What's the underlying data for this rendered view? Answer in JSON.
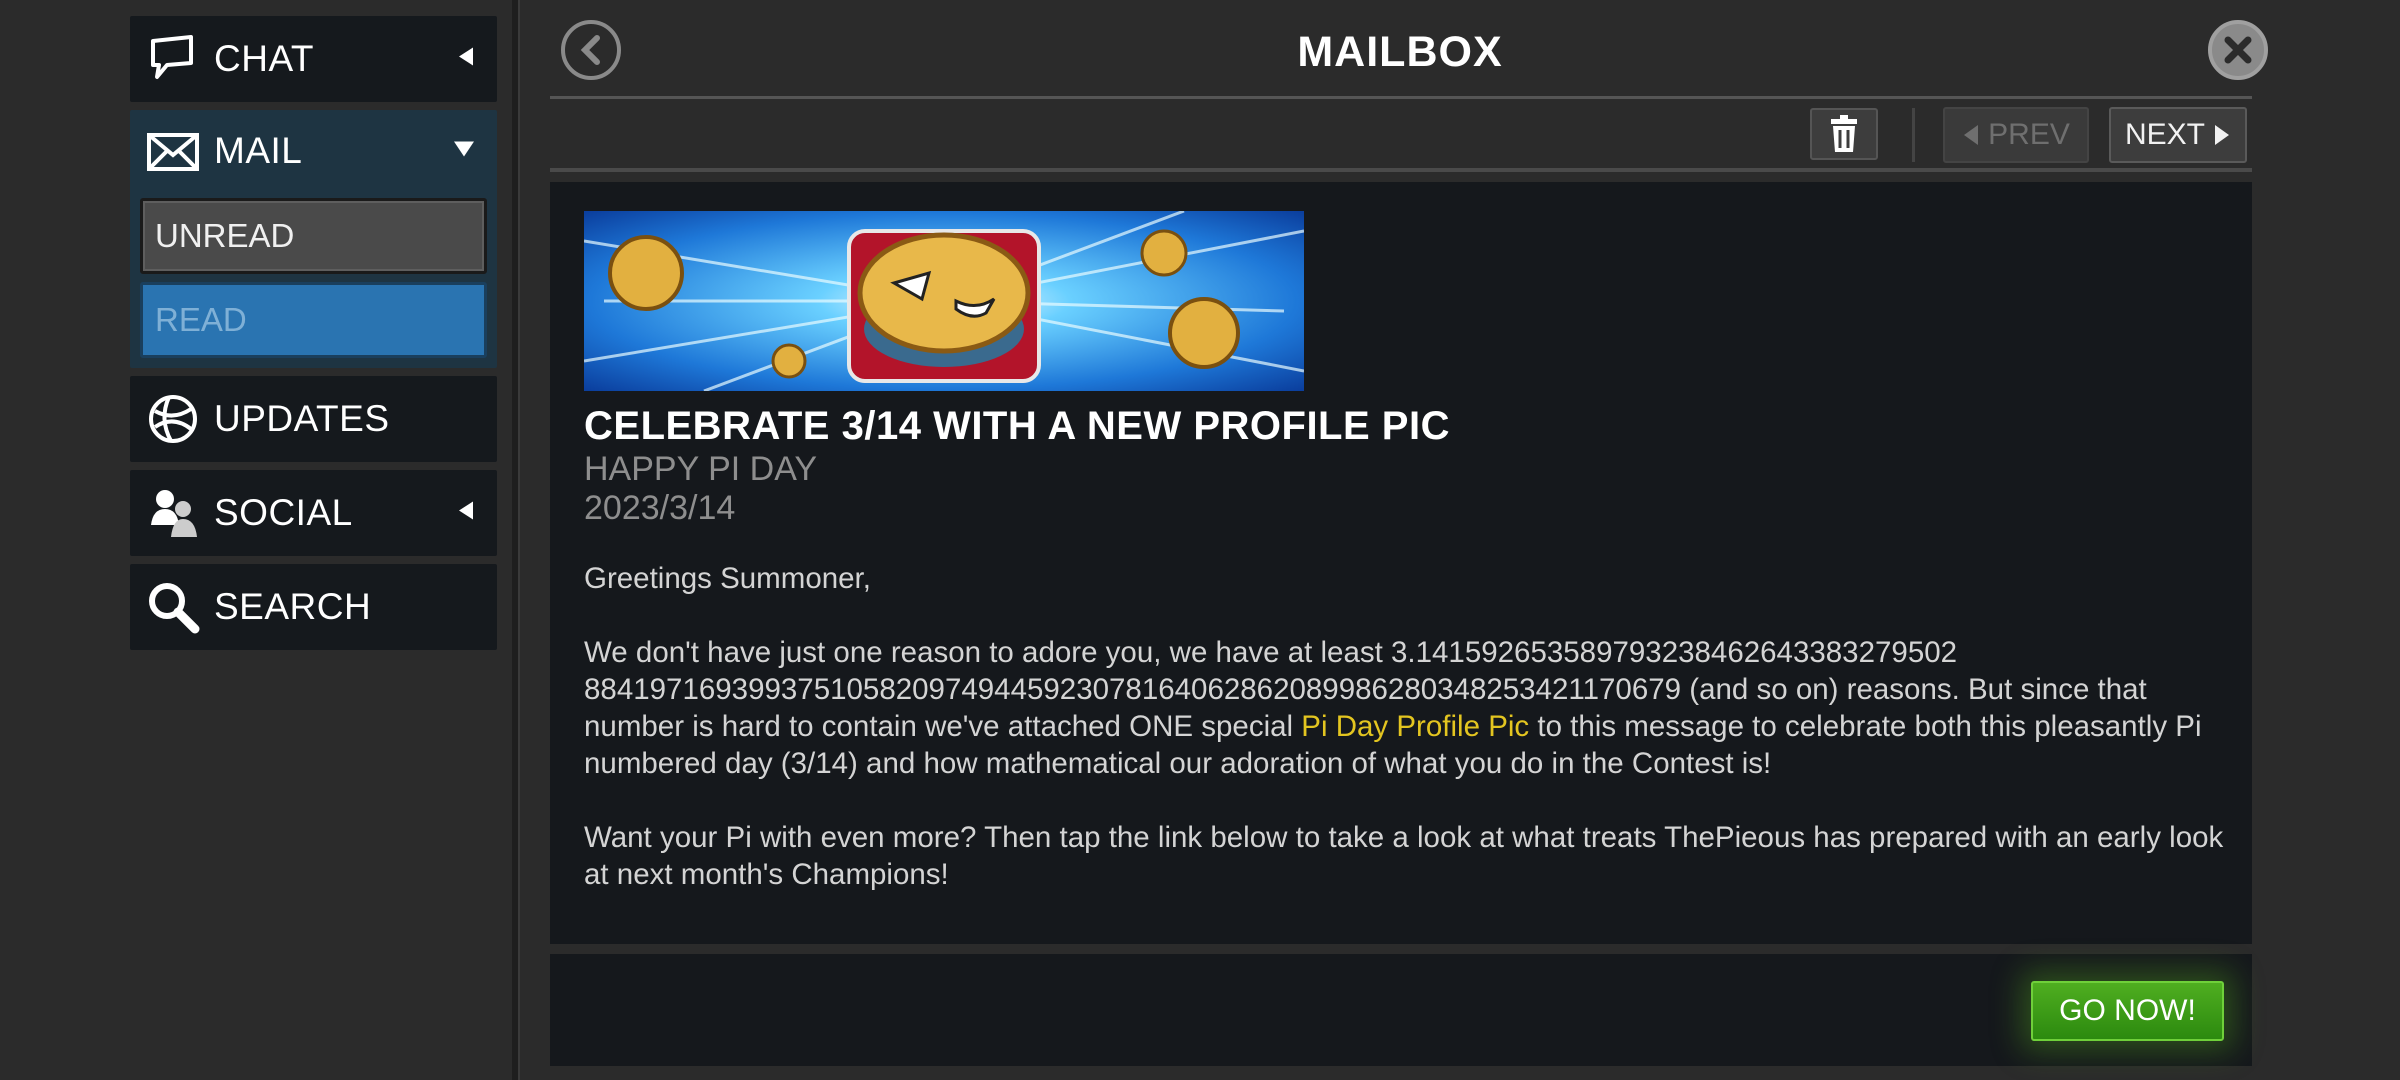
{
  "sidebar": {
    "chat_label": "CHAT",
    "mail_label": "MAIL",
    "unread_label": "UNREAD",
    "read_label": "READ",
    "updates_label": "UPDATES",
    "social_label": "SOCIAL",
    "search_label": "SEARCH"
  },
  "header": {
    "title": "MAILBOX"
  },
  "toolbar": {
    "prev_label": "PREV",
    "next_label": "NEXT"
  },
  "message": {
    "title": "CELEBRATE 3/14 WITH A NEW PROFILE PIC",
    "subtitle": "HAPPY PI DAY",
    "date": "2023/3/14",
    "greeting": "Greetings Summoner,",
    "para1_line1": "We don't have just one reason to adore you, we have at least 3.14159265358979323846264338327950288419716939937510582097494459230781640628620899862803482534211706 79 (and so on)",
    "para1_a": "We don't have just one reason to adore you, we have at least 3.141592653589793238462643383279502 8841971693993751058209749445923078164062862089986280348253421170679 (and so on) reasons. But since that number is hard to contain we've attached ONE special ",
    "link_text": "Pi Day Profile Pic",
    "para1_b": " to this message to celebrate both this pleasantly Pi numbered day (3/14) and how mathematical our adoration of what you do in the Contest is!",
    "para2": "Want your Pi with even more? Then tap the link below to take a look at what treats ThePieous has prepared with an early look at next month's Champions!"
  },
  "footer": {
    "go_label": "GO NOW!"
  },
  "colors": {
    "accent_blue": "#2a74b1",
    "link_yellow": "#e3c520",
    "go_green": "#3f9c18"
  }
}
